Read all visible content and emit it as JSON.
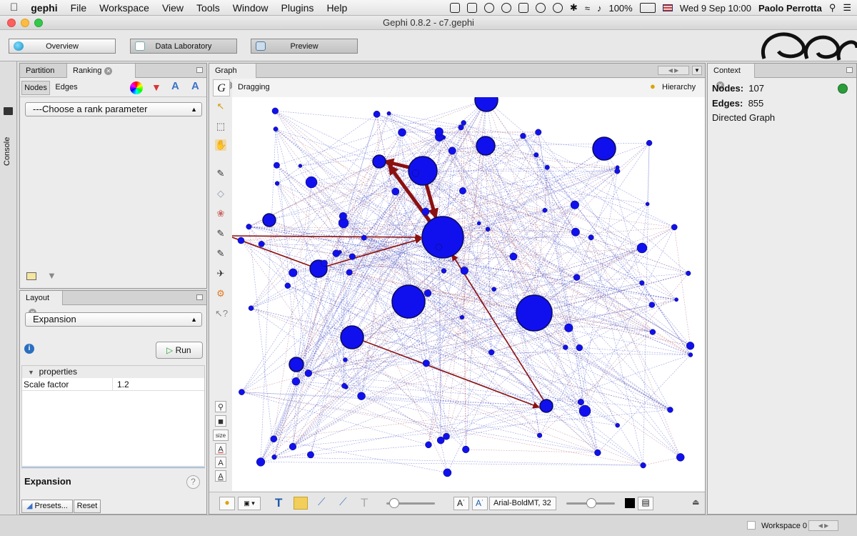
{
  "menubar": {
    "app_name": "gephi",
    "items": [
      "File",
      "Workspace",
      "View",
      "Tools",
      "Window",
      "Plugins",
      "Help"
    ],
    "battery": "100%",
    "datetime": "Wed 9 Sep  10:00",
    "user": "Paolo Perrotta"
  },
  "window": {
    "title": "Gephi 0.8.2 - c7.gephi"
  },
  "toolbar": {
    "overview_label": "Overview",
    "datalab_label": "Data Laboratory",
    "preview_label": "Preview"
  },
  "console": {
    "label": "Console"
  },
  "ranking": {
    "tab_partition": "Partition",
    "tab_ranking": "Ranking",
    "subtab_nodes": "Nodes",
    "subtab_edges": "Edges",
    "rank_param": "---Choose a rank parameter"
  },
  "layout": {
    "tab_label": "Layout",
    "algorithm": "Expansion",
    "run_label": "Run",
    "section": "properties",
    "prop_name": "Scale factor",
    "prop_value": "1.2",
    "description_title": "Expansion",
    "presets_label": "Presets...",
    "reset_label": "Reset"
  },
  "graph": {
    "tab_label": "Graph",
    "mode": "Dragging",
    "hierarchy_label": "Hierarchy",
    "size_label": "size",
    "font_label": "Arial-BoldMT, 32"
  },
  "context": {
    "tab_label": "Context",
    "nodes_label": "Nodes:",
    "nodes_value": "107",
    "edges_label": "Edges:",
    "edges_value": "855",
    "graph_type": "Directed Graph"
  },
  "statusbar": {
    "workspace": "Workspace 0"
  },
  "colors": {
    "node": "#1010ee",
    "edge_blue": "#4a55c8",
    "edge_red": "#8b1010",
    "accent_green": "#2a9d3a"
  }
}
